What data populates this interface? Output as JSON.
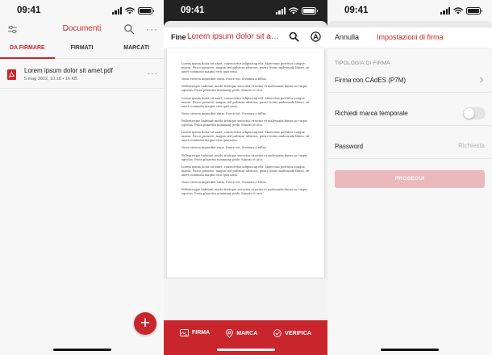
{
  "status_bar": {
    "time": "09:41"
  },
  "documents": {
    "title": "Documenti",
    "more_label": "···",
    "tabs": [
      {
        "label": "DA FIRMARE",
        "active": true
      },
      {
        "label": "FIRMATI",
        "active": false
      },
      {
        "label": "MARCATI",
        "active": false
      }
    ],
    "file": {
      "name": "Lorem ipsum dolor sit amet.pdf",
      "meta": "5 mag 2022, 10:18 • 16 KB"
    },
    "fab_label": "+"
  },
  "viewer": {
    "done_label": "Fine",
    "title": "Lorem ipsum dolor sit amet.pdf",
    "paragraphs": [
      "Lorem ipsum dolor sit amet, consectetur adipiscing elit. Maecenas porttitor congue massa. Fusce posuere, magna sed pulvinar ultricies, purus lectus malesuada libero, sit amet commodo magna eros quis urna.",
      "Nunc viverra imperdiet enim. Fusce est. Vivamus a tellus.",
      "Pellentesque habitant morbi tristique senectus et netus et malesuada fames ac turpis egestas. Proin pharetra nonummy pede. Mauris et orci.",
      "Lorem ipsum dolor sit amet, consectetur adipiscing elit. Maecenas porttitor congue massa. Fusce posuere, magna sed pulvinar ultricies, purus lectus malesuada libero, sit amet commodo magna eros quis urna.",
      "Nunc viverra imperdiet enim. Fusce est. Vivamus a tellus.",
      "Pellentesque habitant morbi tristique senectus et netus et malesuada fames ac turpis egestas. Proin pharetra nonummy pede. Mauris et orci.",
      "Lorem ipsum dolor sit amet, consectetur adipiscing elit. Maecenas porttitor congue massa. Fusce posuere, magna sed pulvinar ultricies, purus lectus malesuada libero, sit amet commodo magna eros quis urna.",
      "Nunc viverra imperdiet enim. Fusce est. Vivamus a tellus.",
      "Pellentesque habitant morbi tristique senectus et netus et malesuada fames ac turpis egestas. Proin pharetra nonummy pede. Mauris et orci.",
      "Lorem ipsum dolor sit amet, consectetur adipiscing elit. Maecenas porttitor congue massa. Fusce posuere, magna sed pulvinar ultricies, purus lectus malesuada libero, sit amet commodo magna eros quis urna.",
      "Nunc viverra imperdiet enim. Fusce est. Vivamus a tellus.",
      "Pellentesque habitant morbi tristique senectus et netus et malesuada fames ac turpis egestas. Proin pharetra nonummy pede. Mauris et orci."
    ],
    "actions": {
      "sign": "FIRMA",
      "stamp": "MARCA",
      "verify": "VERIFICA"
    }
  },
  "signature_settings": {
    "cancel_label": "Annulla",
    "title": "Impostazioni di firma",
    "section_label": "TIPOLOGIA DI FIRMA",
    "signature_type": "Firma con CAdES (P7M)",
    "timestamp_label": "Richiedi marca temporale",
    "timestamp_enabled": false,
    "password_label": "Password",
    "password_placeholder": "Richiesta",
    "continue_label": "PROSEGUI"
  },
  "colors": {
    "accent": "#c8252d",
    "accent_disabled": "#ebb9bb"
  }
}
